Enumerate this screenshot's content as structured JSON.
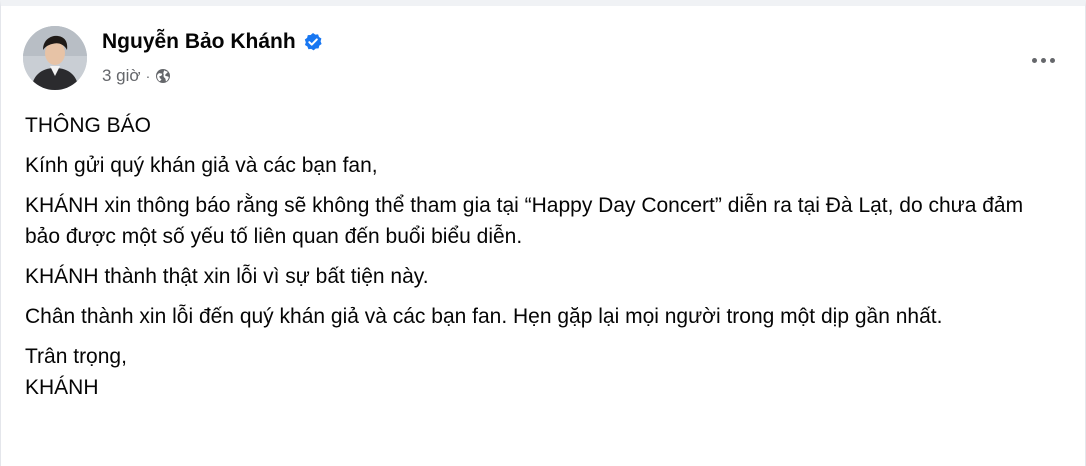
{
  "post": {
    "author": {
      "name": "Nguyễn Bảo Khánh",
      "verified_icon": "verified-badge-icon",
      "avatar_icon": "avatar"
    },
    "timestamp": "3 giờ",
    "separator": "·",
    "privacy_icon": "globe-icon",
    "more_icon": "more-options-icon",
    "accent_color": "#1877f2",
    "paragraphs": [
      "THÔNG BÁO",
      "Kính gửi quý khán giả và các bạn fan,",
      "KHÁNH xin thông báo rằng sẽ không thể tham gia tại “Happy Day Concert” diễn ra tại Đà Lạt, do chưa đảm bảo được một số yếu tố liên quan đến buổi biểu diễn.",
      "KHÁNH thành thật xin lỗi vì sự bất tiện này.",
      "Chân thành xin lỗi đến quý khán giả và các bạn fan. Hẹn gặp lại mọi người trong một dịp gần nhất.",
      "Trân trọng,",
      "KHÁNH"
    ]
  }
}
